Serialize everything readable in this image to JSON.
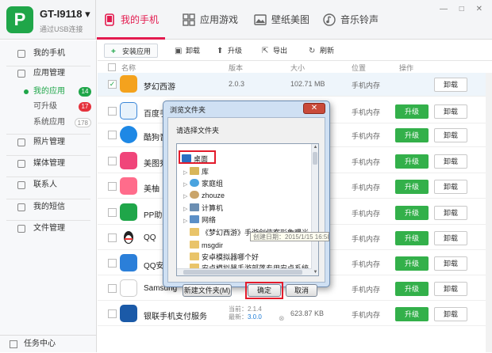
{
  "device": {
    "name": "GT-I9118",
    "subtitle": "通过USB连接"
  },
  "tabs": [
    {
      "label": "我的手机"
    },
    {
      "label": "应用游戏"
    },
    {
      "label": "壁纸美图"
    },
    {
      "label": "音乐铃声"
    }
  ],
  "window_controls": "— □ ✕",
  "sidebar": {
    "items": [
      {
        "label": "我的手机"
      },
      {
        "label": "应用管理"
      },
      {
        "label": "照片管理"
      },
      {
        "label": "媒体管理"
      },
      {
        "label": "联系人"
      },
      {
        "label": "我的短信"
      },
      {
        "label": "文件管理"
      }
    ],
    "subitems": [
      {
        "label": "我的应用",
        "count": "14"
      },
      {
        "label": "可升级",
        "count": "17"
      },
      {
        "label": "系统应用",
        "count": "178"
      }
    ],
    "footer": "任务中心"
  },
  "toolbar": {
    "install": "安装应用",
    "uninstall": "卸载",
    "upgrade": "升级",
    "export": "导出",
    "refresh": "刷新"
  },
  "table": {
    "headers": {
      "name": "名称",
      "version": "版本",
      "size": "大小",
      "location": "位置",
      "action": "操作"
    },
    "rows": [
      {
        "name": "梦幻西游",
        "version": "2.0.3",
        "size": "102.71 MB",
        "location": "手机内存",
        "upgrade": "",
        "uninstall": "卸载",
        "color": "#f4a21d"
      },
      {
        "name": "百度手",
        "version": "",
        "size": "",
        "location": "手机内存",
        "upgrade": "升级",
        "uninstall": "卸载",
        "color": "#e8f2fb"
      },
      {
        "name": "酷狗音",
        "version": "",
        "size": "",
        "location": "手机内存",
        "upgrade": "升级",
        "uninstall": "卸载",
        "color": "#1e88e5"
      },
      {
        "name": "美图秀",
        "version": "",
        "size": "",
        "location": "手机内存",
        "upgrade": "升级",
        "uninstall": "卸载",
        "color": "#f0457a"
      },
      {
        "name": "美柚",
        "version": "",
        "size": "",
        "location": "手机内存",
        "upgrade": "升级",
        "uninstall": "卸载",
        "color": "#ff6c8b"
      },
      {
        "name": "PP助手",
        "version": "",
        "size": "",
        "location": "手机内存",
        "upgrade": "升级",
        "uninstall": "卸载",
        "color": "#1fa649"
      },
      {
        "name": "QQ",
        "version": "",
        "size": "",
        "location": "手机内存",
        "upgrade": "升级",
        "uninstall": "卸载",
        "color": "#ffffff"
      },
      {
        "name": "QQ安全",
        "version": "",
        "size": "",
        "location": "手机内存",
        "upgrade": "升级",
        "uninstall": "卸载",
        "color": "#2b7fd9"
      },
      {
        "name": "Samsung",
        "version": "",
        "size": "",
        "location": "手机内存",
        "upgrade": "升级",
        "uninstall": "卸载",
        "color": "#ffffff"
      },
      {
        "name": "银联手机支付服务",
        "version_cur": "当前：2.1.4",
        "version_new": "最新：",
        "version_new_val": "3.0.0",
        "size": "623.87 KB",
        "location": "手机内存",
        "upgrade": "升级",
        "uninstall": "卸载",
        "color": "#1b5aa8"
      }
    ]
  },
  "dialog": {
    "title": "浏览文件夹",
    "prompt": "请选择文件夹",
    "tree": [
      {
        "label": "桌面"
      },
      {
        "label": "库"
      },
      {
        "label": "家庭组"
      },
      {
        "label": "zhouze"
      },
      {
        "label": "计算机"
      },
      {
        "label": "网络"
      },
      {
        "label": "《梦幻西游》手游剑侠客形象曝光"
      },
      {
        "label": "msgdir"
      },
      {
        "label": "安卓模拟器哪个好"
      },
      {
        "label": "安卓模拟器手游部落专用安卓系统"
      }
    ],
    "new_folder": "新建文件夹(M)",
    "ok": "确定",
    "cancel": "取消",
    "tooltip": "创建日期：2015/1/15 16:58"
  },
  "colors": {
    "accent": "#e31b4f",
    "brand": "#1fa649",
    "highlight_box": "#e31b2b"
  }
}
